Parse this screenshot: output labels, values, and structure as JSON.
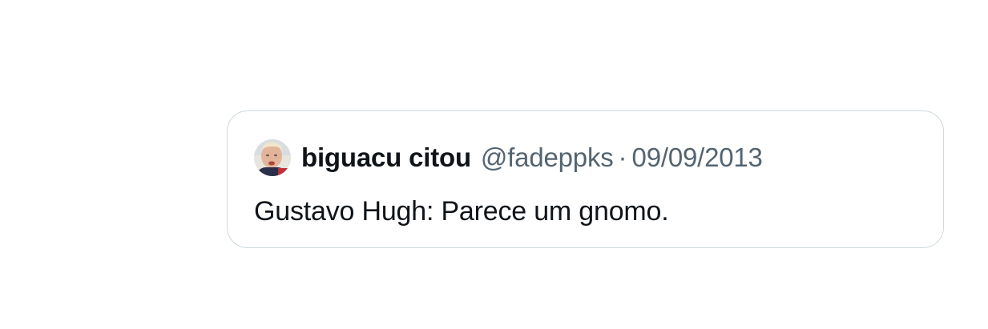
{
  "quoted_tweet": {
    "avatar_icon": "profile-photo-icon",
    "display_name": "biguacu citou",
    "handle": "@fadeppks",
    "separator": "·",
    "date": "09/09/2013",
    "text": "Gustavo Hugh: Parece um gnomo."
  },
  "colors": {
    "border": "#cfd9de",
    "primary_text": "#0f1419",
    "secondary_text": "#536471"
  }
}
